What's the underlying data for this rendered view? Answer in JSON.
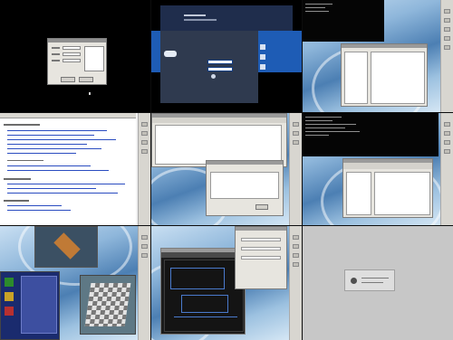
{
  "screen": {
    "rows": 3,
    "cols": 3
  },
  "tiles": [
    {
      "id": "login-dialog-on-black-desktop"
    },
    {
      "id": "graphical-login-screen"
    },
    {
      "id": "terminal-and-file-manager"
    },
    {
      "id": "web-browser-document"
    },
    {
      "id": "text-editor-and-dialog"
    },
    {
      "id": "terminal-and-spreadsheet-manager"
    },
    {
      "id": "games-desktop"
    },
    {
      "id": "dark-schematic-editor"
    },
    {
      "id": "blank-gray-with-message"
    }
  ],
  "colors": {
    "desktop_black": "#000000",
    "login_blue": "#1e5cb5",
    "wallpaper_blue": "#4c7fb3",
    "panel_gray": "#d8d6d0",
    "window_gray": "#e7e5df",
    "link_blue": "#2a4cc0"
  }
}
